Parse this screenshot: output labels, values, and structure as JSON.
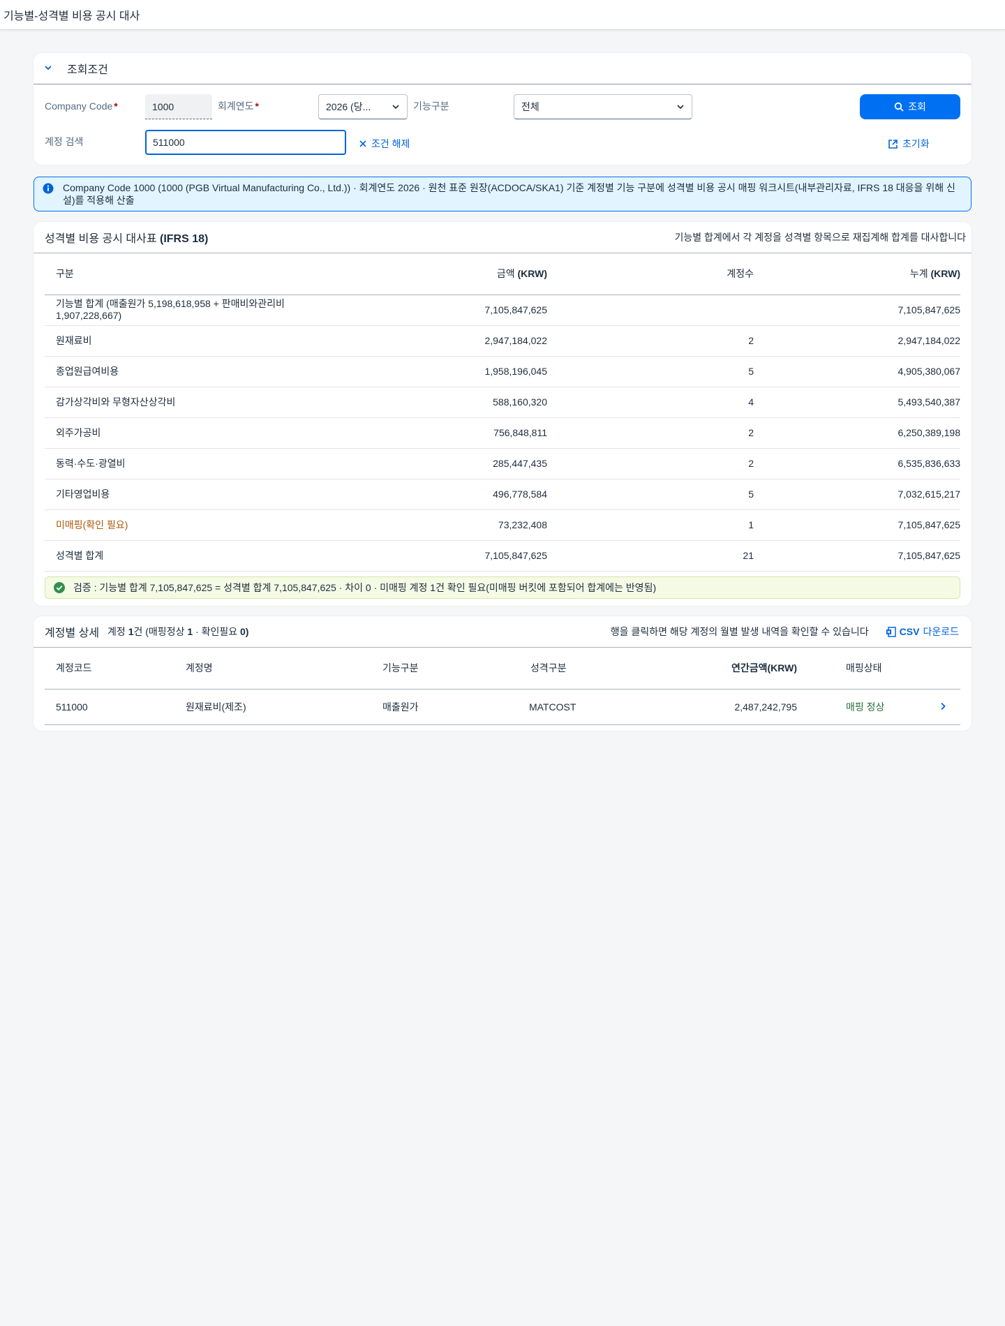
{
  "shell": {
    "title": "기능별-성격별 비용 공시 대사"
  },
  "filter": {
    "header": "조회조건",
    "company_code_label": "Company Code",
    "company_code_value": "1000",
    "fiscal_year_label": "회계연도",
    "fiscal_year_value": "2026 (당...",
    "function_label": "기능구분",
    "function_value": "전체",
    "account_search_label": "계정 검색",
    "account_search_value": "511000",
    "clear_label": "조건 해제",
    "search_button": "조회",
    "reset_label": "초기화"
  },
  "info": {
    "text": "Company Code 1000 (1000 (PGB Virtual Manufacturing Co., Ltd.)) · 회계연도 2026 · 원천 표준 원장(ACDOCA/SKA1) 기준 계정별 기능 구분에 성격별 비용 공시 매핑 워크시트(내부관리자료, IFRS 18 대응을 위해 신설)를 적용해 산출"
  },
  "summary": {
    "title": "성격별 비용 공시 대사표",
    "title_bold": "(IFRS 18)",
    "hint": "기능별 합계에서 각 계정을 성격별 항목으로 재집계해 합계를 대사합니다",
    "columns": [
      "구분",
      "금액",
      "(KRW)",
      "계정수",
      "누계",
      "(KRW)"
    ],
    "rows": [
      {
        "label": "기능별 합계 (매출원가 5,198,618,958 + 판매비와관리비 1,907,228,667)",
        "amount": "7,105,847,625",
        "count": "",
        "cum": "7,105,847,625"
      },
      {
        "label": "원재료비",
        "amount": "2,947,184,022",
        "count": "2",
        "cum": "2,947,184,022"
      },
      {
        "label": "종업원급여비용",
        "amount": "1,958,196,045",
        "count": "5",
        "cum": "4,905,380,067"
      },
      {
        "label": "감가상각비와 무형자산상각비",
        "amount": "588,160,320",
        "count": "4",
        "cum": "5,493,540,387"
      },
      {
        "label": "외주가공비",
        "amount": "756,848,811",
        "count": "2",
        "cum": "6,250,389,198"
      },
      {
        "label": "동력·수도·광열비",
        "amount": "285,447,435",
        "count": "2",
        "cum": "6,535,836,633"
      },
      {
        "label": "기타영업비용",
        "amount": "496,778,584",
        "count": "5",
        "cum": "7,032,615,217"
      },
      {
        "label": "미매핑(확인 필요)",
        "amount": "73,232,408",
        "count": "1",
        "cum": "7,105,847,625"
      },
      {
        "label": "성격별 합계",
        "amount": "7,105,847,625",
        "count": "21",
        "cum": "7,105,847,625"
      }
    ],
    "verify": "검증 : 기능별 합계 7,105,847,625 = 성격별 합계 7,105,847,625 · 차이 0 · 미매핑 계정 1건 확인 필요(미매핑 버킷에 포함되어 합계에는 반영됨)"
  },
  "detail": {
    "title": "계정별 상세",
    "count_prefix": "계정",
    "count_value": "1",
    "count_suffix": "건 (매핑정상",
    "ok_count": "1",
    "mid": "· 확인필요",
    "check_count": "0",
    "close": ")",
    "hint": "행을 클릭하면 해당 계정의 월별 발생 내역을 확인할 수 있습니다",
    "csv_bold": "CSV",
    "csv_label": "다운로드",
    "columns": [
      "계정코드",
      "계정명",
      "기능구분",
      "성격구분",
      "연간금액(KRW)",
      "매핑상태"
    ],
    "rows": [
      {
        "code": "511000",
        "name": "원재료비(제조)",
        "function": "매출원가",
        "nature": "MATCOST",
        "amount": "2,487,242,795",
        "status": "매핑 정상"
      }
    ]
  },
  "colors": {
    "accent": "#0070f2",
    "info_bg": "#e1f4ff",
    "success": "#256f3a",
    "warning": "#aa5808"
  }
}
